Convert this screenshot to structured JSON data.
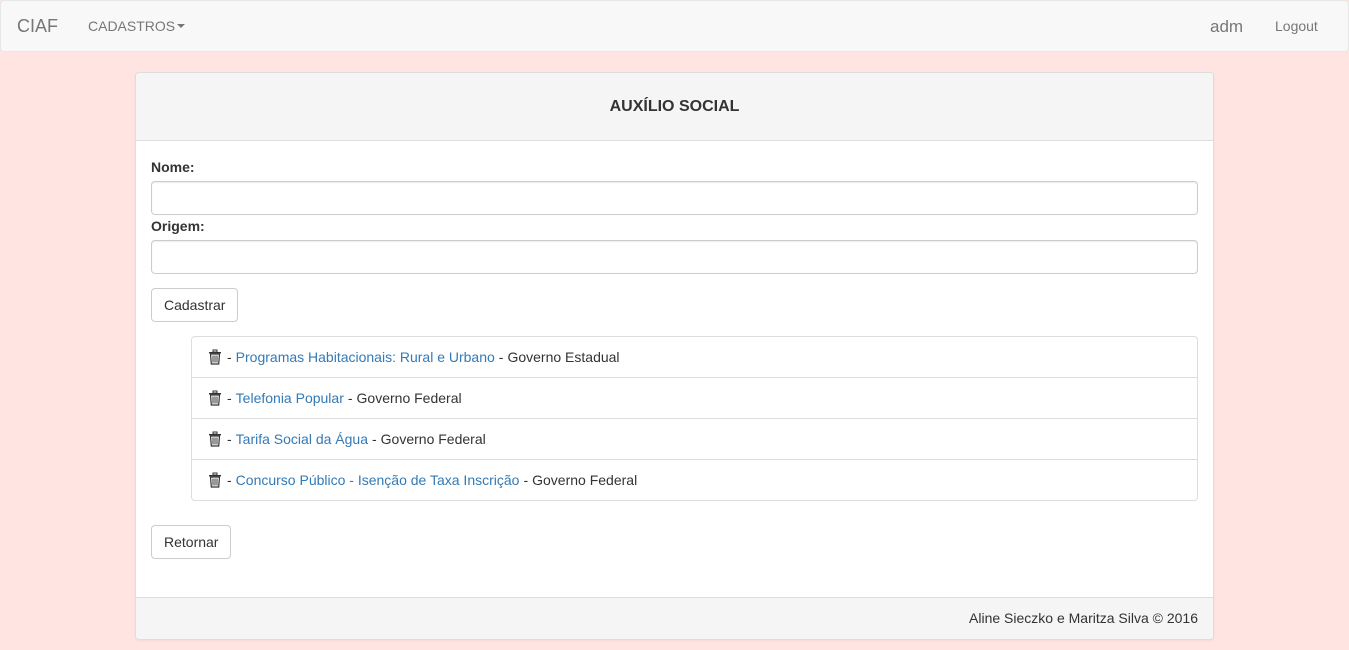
{
  "navbar": {
    "brand": "CIAF",
    "menu_label": "CADASTROS",
    "user": "adm",
    "logout": "Logout"
  },
  "panel": {
    "title": "AUXÍLIO SOCIAL"
  },
  "form": {
    "nome_label": "Nome:",
    "nome_value": "",
    "origem_label": "Origem:",
    "origem_value": "",
    "submit_label": "Cadastrar"
  },
  "separator": "-",
  "items": [
    {
      "name": "Programas Habitacionais: Rural e Urbano",
      "origin": "Governo Estadual"
    },
    {
      "name": "Telefonia Popular",
      "origin": "Governo Federal"
    },
    {
      "name": "Tarifa Social da Água",
      "origin": "Governo Federal"
    },
    {
      "name": "Concurso Público - Isenção de Taxa Inscrição",
      "origin": "Governo Federal"
    }
  ],
  "back_label": "Retornar",
  "footer": {
    "text": "Aline Sieczko e Maritza Silva © 2016"
  },
  "colors": {
    "background": "#ffe4e1",
    "link": "#337ab7"
  },
  "icons": {
    "delete": "trash-icon"
  }
}
